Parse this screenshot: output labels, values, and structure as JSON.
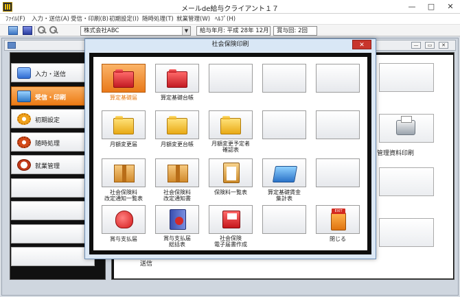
{
  "window": {
    "title": "メールde給与クライアント１７",
    "minimize": "—",
    "maximize": "□",
    "close": "✕"
  },
  "menu": [
    "ﾌｧｲﾙ(F)",
    "入力・送信(A)",
    "受信・印刷(B)",
    "初期設定(I)",
    "随時処理(T)",
    "就業管理(W)",
    "ﾍﾙﾌﾟ(H)"
  ],
  "toolbar": {
    "company": "株式会社ABC",
    "combo_arrow": "▼",
    "pay_month": "給与年月: 平成 28年 12月",
    "bonus_count": "賞与回: 2回"
  },
  "child_window": {
    "min": "—",
    "restore": "▭",
    "close": "✕"
  },
  "sidebar": {
    "items": [
      {
        "label": "入力・送信"
      },
      {
        "label": "受信・印刷"
      },
      {
        "label": "初期設定"
      },
      {
        "label": "随時処理"
      },
      {
        "label": "就業管理"
      }
    ]
  },
  "main": {
    "management_print": "管理資料印刷",
    "partial_label": "送信"
  },
  "dialog": {
    "title": "社会保険印刷",
    "close": "✕",
    "grid": {
      "row1": [
        "算定基礎届",
        "算定基礎台帳"
      ],
      "row2": [
        "月額変更届",
        "月額変更台帳",
        "月額変更予定者\n確認表"
      ],
      "row3": [
        "社会保険料\n改定通知一覧表",
        "社会保険料\n改定通知書",
        "保険料一覧表",
        "算定基礎賃金\n集計表"
      ],
      "row4": [
        "賞与支払届",
        "賞与支払届\n総括表",
        "社会保険\n電子届書作成",
        "閉じる"
      ]
    },
    "exit_tag": "EXIT"
  }
}
